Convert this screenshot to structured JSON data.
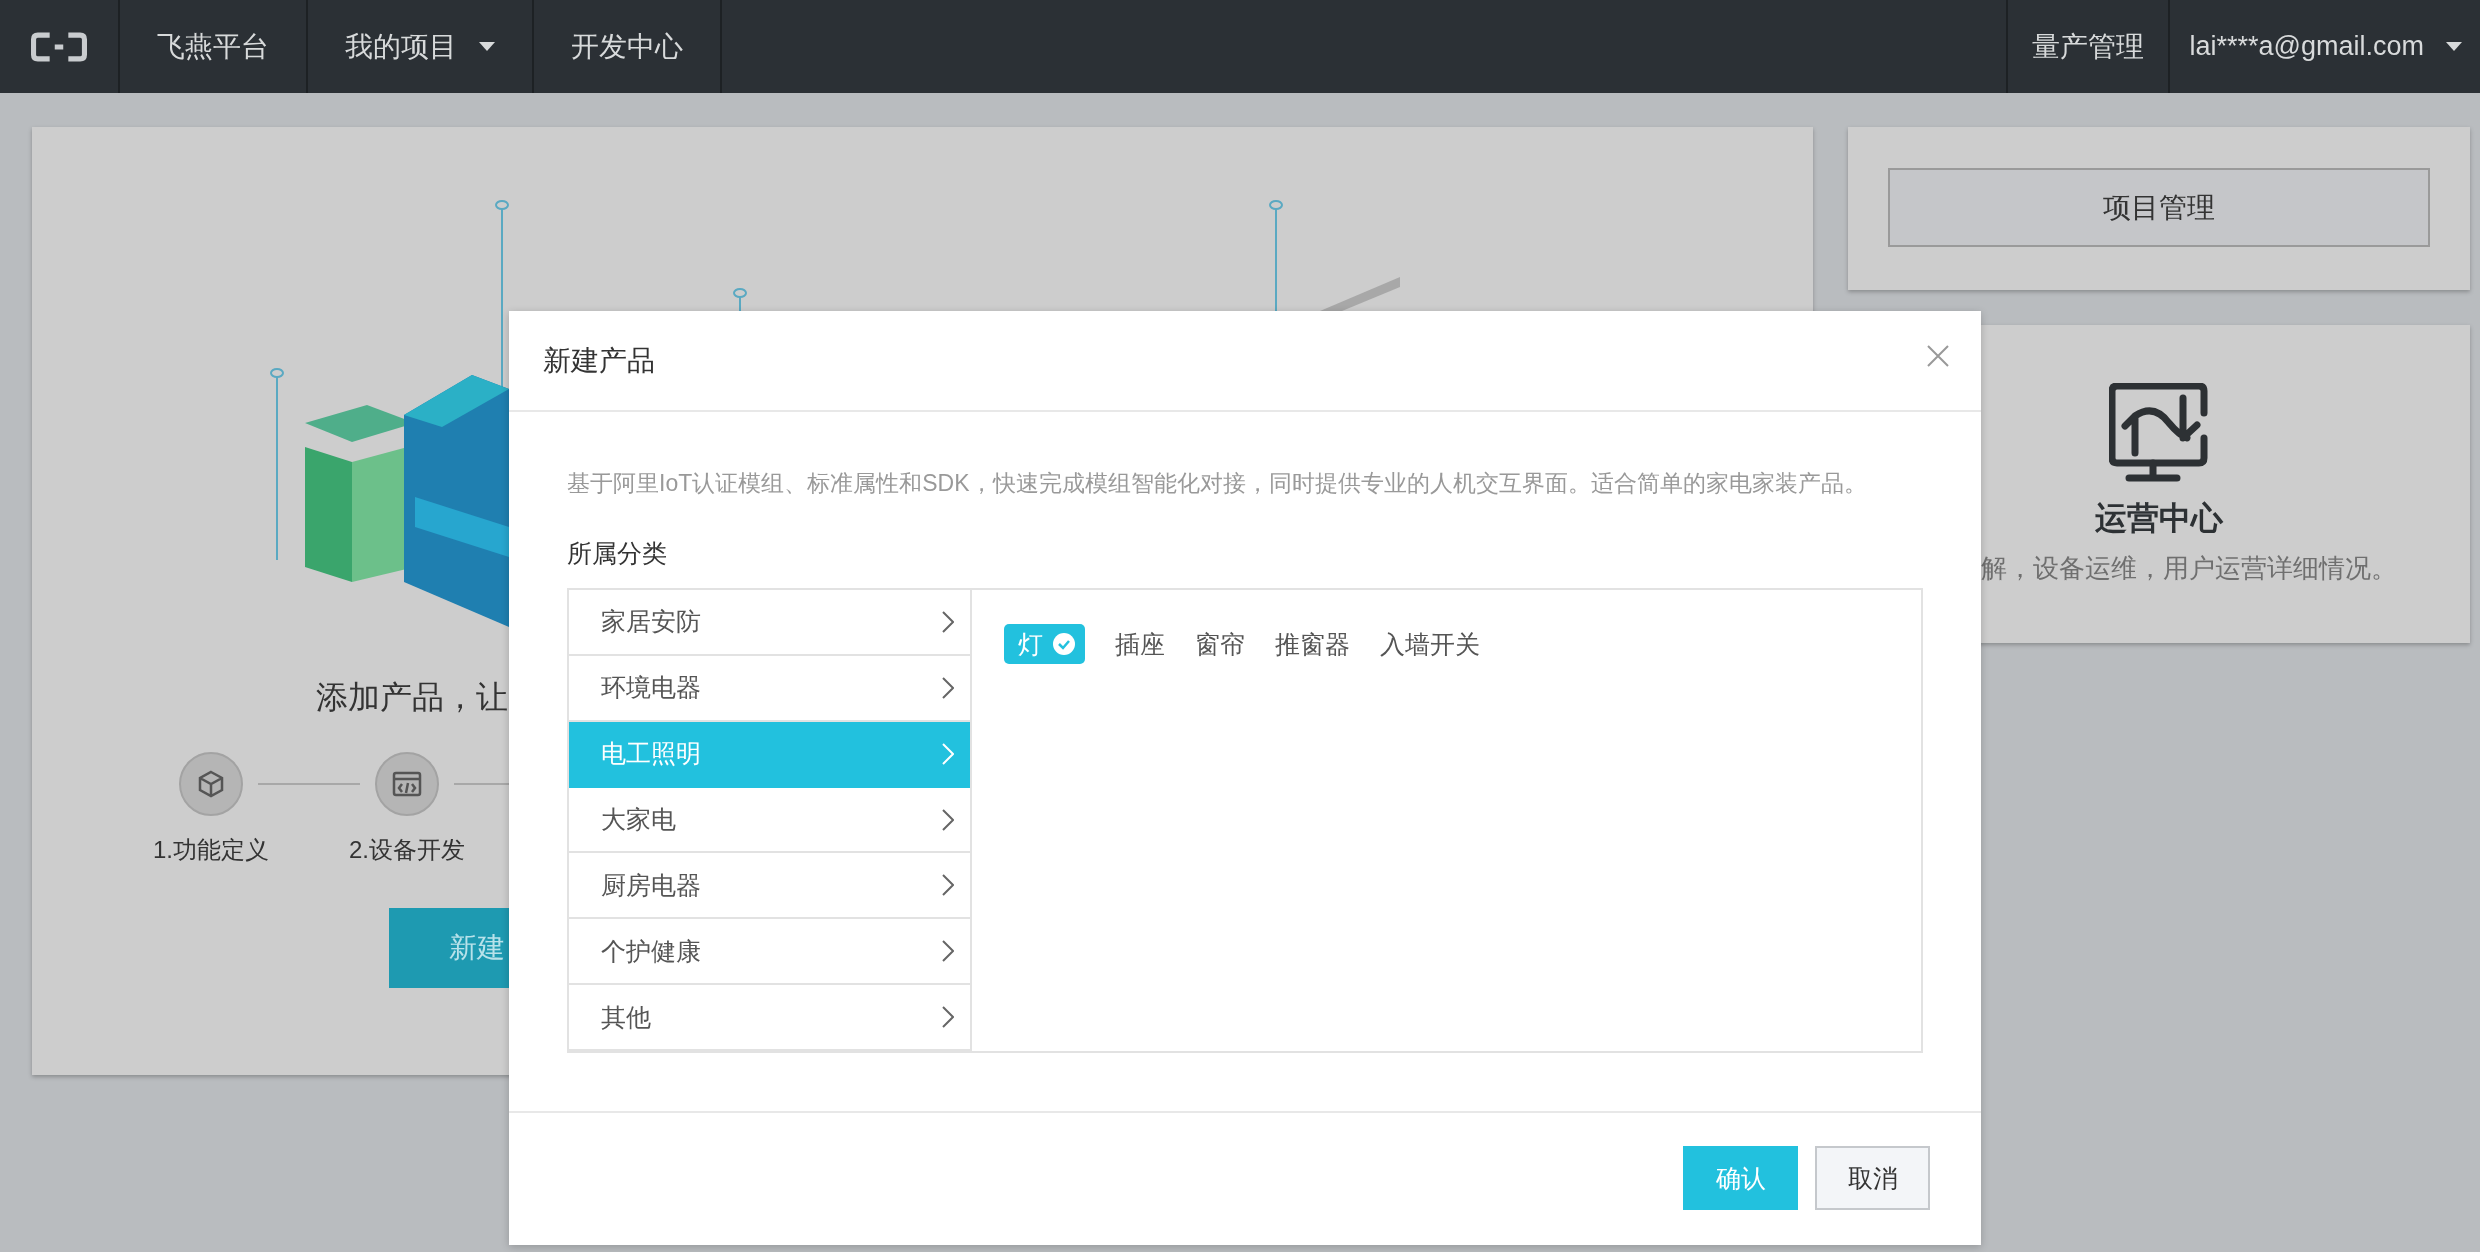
{
  "top_bar": {
    "nav_items": [
      {
        "label": "飞燕平台",
        "dropdown": false
      },
      {
        "label": "我的项目",
        "dropdown": true
      },
      {
        "label": "开发中心",
        "dropdown": false
      }
    ],
    "right_items": [
      {
        "label": "量产管理",
        "dropdown": false
      },
      {
        "label": "lai****a@gmail.com",
        "dropdown": true
      }
    ]
  },
  "intro_card": {
    "headline": "添加产品，让",
    "steps": [
      {
        "label": "1.功能定义",
        "kind": "cube"
      },
      {
        "label": "2.设备开发",
        "kind": "code"
      }
    ],
    "button": "新建"
  },
  "side_cards": {
    "project_button": "项目管理",
    "operations": {
      "title": "运营中心",
      "description": "解，设备运维，用户运营详细情况。"
    }
  },
  "dialog": {
    "title": "新建产品",
    "description": "基于阿里IoT认证模组、标准属性和SDK，快速完成模组智能化对接，同时提供专业的人机交互界面。适合简单的家电家装产品。",
    "category_label": "所属分类",
    "categories": [
      {
        "label": "家居安防",
        "selected": false
      },
      {
        "label": "环境电器",
        "selected": false
      },
      {
        "label": "电工照明",
        "selected": true
      },
      {
        "label": "大家电",
        "selected": false
      },
      {
        "label": "厨房电器",
        "selected": false
      },
      {
        "label": "个护健康",
        "selected": false
      },
      {
        "label": "其他",
        "selected": false
      }
    ],
    "subcategories": [
      {
        "label": "灯",
        "selected": true
      },
      {
        "label": "插座",
        "selected": false
      },
      {
        "label": "窗帘",
        "selected": false
      },
      {
        "label": "推窗器",
        "selected": false
      },
      {
        "label": "入墙开关",
        "selected": false
      }
    ],
    "buttons": [
      {
        "label": "确认",
        "kind": "primary"
      },
      {
        "label": "取消",
        "kind": "secondary"
      }
    ]
  }
}
